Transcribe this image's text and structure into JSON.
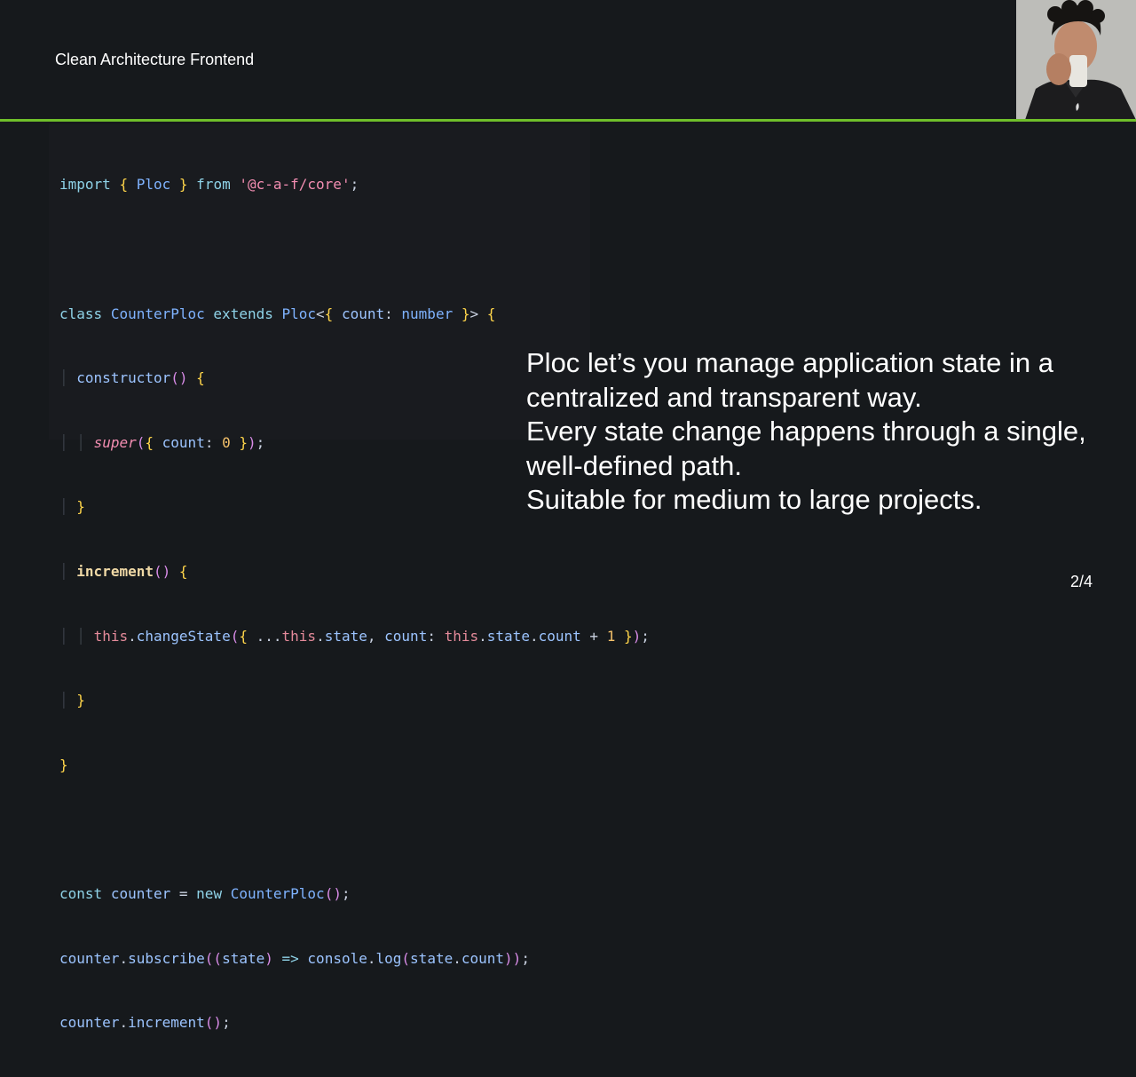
{
  "slide": {
    "title": "Clean Architecture Frontend",
    "page_number": "2/4"
  },
  "code_snippet": {
    "lines": [
      "import { Ploc } from '@c-a-f/core';",
      "",
      "class CounterPloc extends Ploc<{ count: number }> {",
      "  constructor() {",
      "    super({ count: 0 });",
      "  }",
      "  increment() {",
      "    this.changeState({ ...this.state, count: this.state.count + 1 });",
      "  }",
      "}",
      "",
      "const counter = new CounterPloc();",
      "counter.subscribe((state) => console.log(state.count));",
      "counter.increment();"
    ]
  },
  "description": {
    "lines": [
      "Ploc let’s you manage application state in a",
      "centralized and transparent way.",
      "Every state change happens through a single,",
      "well-defined path.",
      "Suitable for medium to large projects."
    ]
  },
  "colors": {
    "background": "#16191c",
    "accent_divider": "#6fbf2a",
    "code_background": "#191b1f",
    "text": "#ffffff"
  },
  "icons": {
    "avatar": "presenter-photo"
  }
}
